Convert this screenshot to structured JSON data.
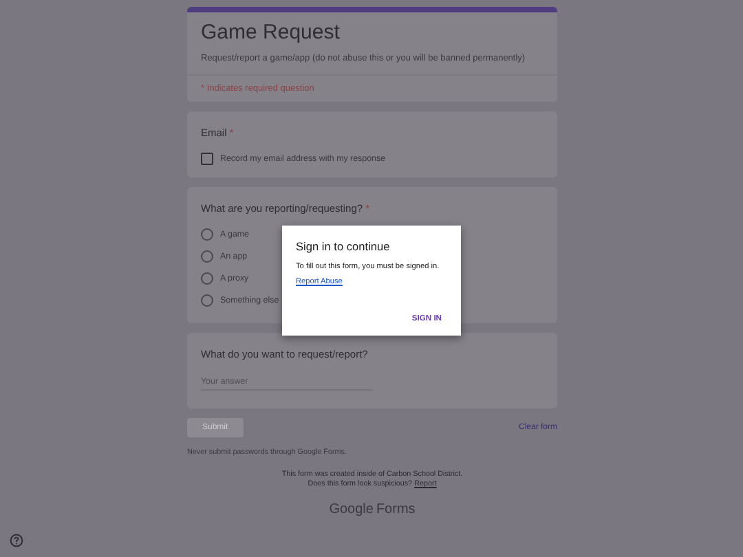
{
  "form": {
    "title": "Game Request",
    "description": "Request/report a game/app (do not abuse this or you will be banned permanently)",
    "required_note": "* Indicates required question"
  },
  "questions": [
    {
      "kind": "email",
      "label": "Email",
      "required_mark": "*",
      "checkbox": {
        "label": "Record my email address with my response",
        "checked": false
      }
    },
    {
      "kind": "radio",
      "label": "What are you reporting/requesting?",
      "required_mark": "*",
      "options": [
        {
          "label": "A game",
          "selected": false
        },
        {
          "label": "An app",
          "selected": false
        },
        {
          "label": "A proxy",
          "selected": false
        },
        {
          "label": "Something else",
          "selected": false
        }
      ]
    },
    {
      "kind": "text",
      "label": "What do you want to request/report?",
      "placeholder": "Your answer"
    }
  ],
  "actions": {
    "submit": "Submit",
    "clear": "Clear form"
  },
  "footer": {
    "warning": "Never submit passwords through Google Forms.",
    "created": "This form was created inside of Carbon School District.",
    "suspicious": "Does this form look suspicious?",
    "report": "Report",
    "brand_google": "Google",
    "brand_forms": "Forms"
  },
  "dialog": {
    "title": "Sign in to continue",
    "message": "To fill out this form, you must be signed in.",
    "link": "Report Abuse",
    "button": "SIGN IN"
  }
}
